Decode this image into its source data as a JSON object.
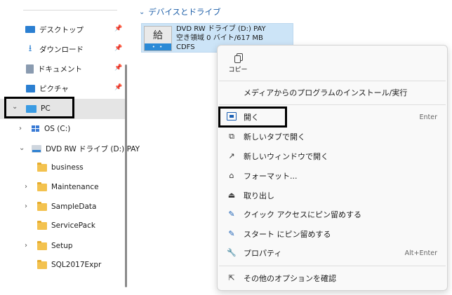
{
  "nav": {
    "quick_access": [
      {
        "label": "デスクトップ",
        "icon": "desktop-icon"
      },
      {
        "label": "ダウンロード",
        "icon": "download-icon"
      },
      {
        "label": "ドキュメント",
        "icon": "documents-icon"
      },
      {
        "label": "ピクチャ",
        "icon": "pictures-icon"
      }
    ],
    "pc": {
      "label": "PC",
      "icon": "pc-icon"
    },
    "os_drive": {
      "label": "OS (C:)"
    },
    "dvd_drive": {
      "label": "DVD RW ドライブ (D:) PAY"
    },
    "folders": [
      {
        "label": "business",
        "expandable": false
      },
      {
        "label": "Maintenance",
        "expandable": true
      },
      {
        "label": "SampleData",
        "expandable": true
      },
      {
        "label": "ServicePack",
        "expandable": false
      },
      {
        "label": "Setup",
        "expandable": true
      },
      {
        "label": "SQL2017Expr",
        "expandable": false
      }
    ]
  },
  "main": {
    "section_title": "デバイスとドライブ",
    "drive_tile": {
      "icon_text": "給",
      "icon_strip": "• •",
      "name": "DVD RW ドライブ (D:) PAY",
      "space": "空き領域 0 バイト/617 MB",
      "filesystem": "CDFS"
    }
  },
  "context_menu": {
    "copy_label": "コピー",
    "items": {
      "install": {
        "label": "メディアからのプログラムのインストール/実行"
      },
      "open": {
        "label": "開く",
        "shortcut": "Enter"
      },
      "open_new_tab": {
        "label": "新しいタブで開く"
      },
      "open_new_window": {
        "label": "新しいウィンドウで開く"
      },
      "format": {
        "label": "フォーマット..."
      },
      "eject": {
        "label": "取り出し"
      },
      "pin_quick_access": {
        "label": "クイック アクセスにピン留めする"
      },
      "pin_start": {
        "label": "スタート にピン留めする"
      },
      "properties": {
        "label": "プロパティ",
        "shortcut": "Alt+Enter"
      },
      "more_options": {
        "label": "その他のオプションを確認"
      }
    }
  },
  "colors": {
    "accent": "#1c5ea8",
    "selection": "#cce4f7",
    "highlight_box": "#000000"
  }
}
